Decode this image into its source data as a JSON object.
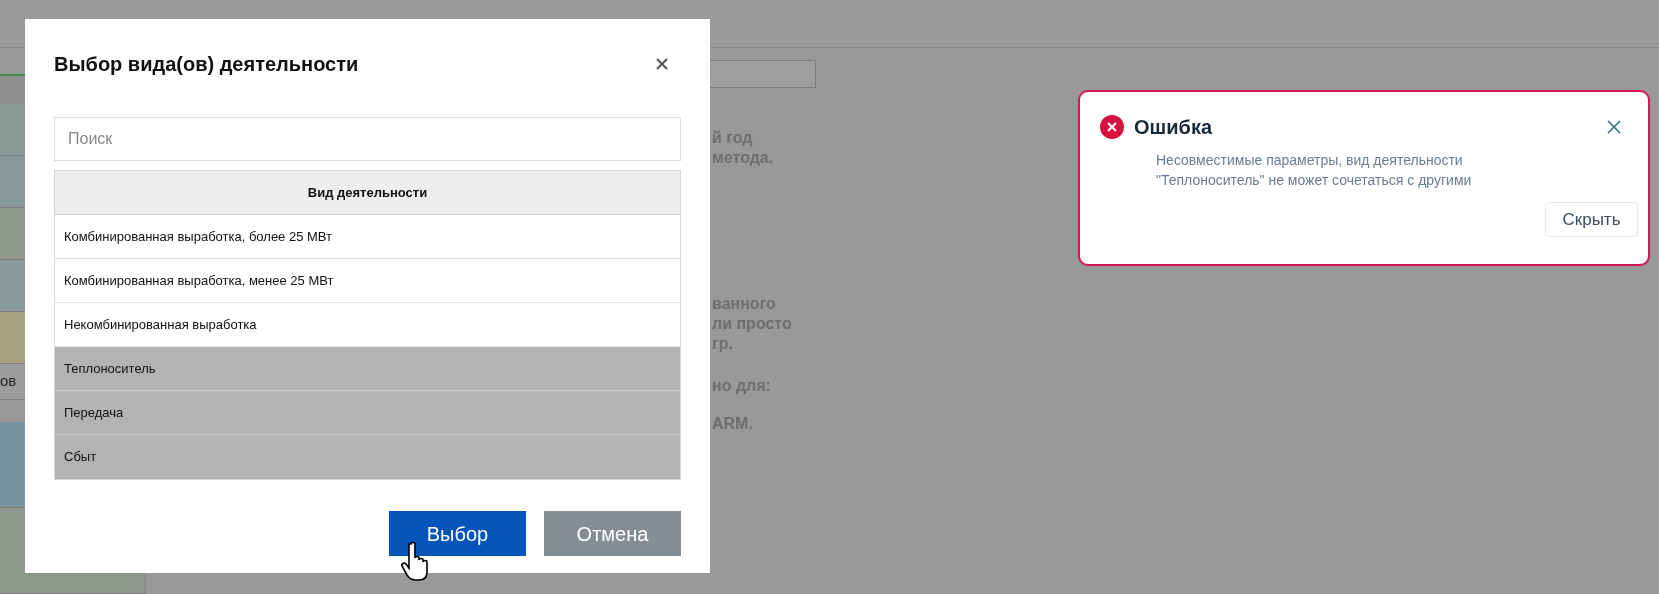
{
  "background": {
    "left_cell": "ов",
    "text_lines": [
      {
        "text": "й год"
      },
      {
        "text": "метода."
      },
      {
        "text": "ванного"
      },
      {
        "text": "ли просто"
      },
      {
        "text": "гр."
      },
      {
        "text": "но для:"
      },
      {
        "text": "ARM."
      }
    ]
  },
  "dialog": {
    "title": "Выбор вида(ов) деятельности",
    "search": {
      "placeholder": "Поиск"
    },
    "table": {
      "columns": [
        "Вид деятельности"
      ],
      "rows": [
        {
          "name": "Комбинированная выработка, более 25 МВт",
          "disabled": false
        },
        {
          "name": "Комбинированная выработка, менее 25 МВт",
          "disabled": false
        },
        {
          "name": "Некомбинированная выработка",
          "disabled": false
        },
        {
          "name": "Теплоноситель",
          "disabled": true
        },
        {
          "name": "Передача",
          "disabled": true
        },
        {
          "name": "Сбыт",
          "disabled": true
        }
      ]
    },
    "buttons": [
      {
        "label": "Выбор",
        "kind": "primary"
      },
      {
        "label": "Отмена",
        "kind": "secondary"
      }
    ]
  },
  "toast": {
    "title": "Ошибка",
    "message": "Несовместимые параметры, вид деятельности \"Теплоноситель\" не может сочетаться с другими",
    "button": "Скрыть"
  }
}
